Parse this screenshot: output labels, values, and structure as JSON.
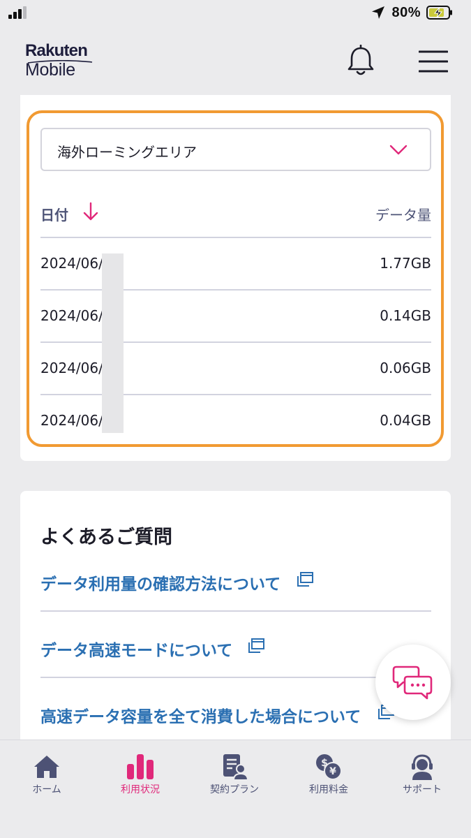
{
  "status_bar": {
    "battery_percent": "80%",
    "icons": [
      "signal-icon",
      "location-arrow-icon",
      "battery-charging-icon"
    ]
  },
  "header": {
    "logo_line1": "Rakuten",
    "logo_line2": "Mobile",
    "icons": [
      "bell-icon",
      "hamburger-menu-icon"
    ]
  },
  "usage_card": {
    "region_select": {
      "value": "海外ローミングエリア",
      "icon": "chevron-down-icon"
    },
    "table": {
      "columns": {
        "date": "日付",
        "data": "データ量"
      },
      "sort_icon": "arrow-down-icon",
      "rows": [
        {
          "date": "2024/06/",
          "value": "1.77GB"
        },
        {
          "date": "2024/06/",
          "value": "0.14GB"
        },
        {
          "date": "2024/06/",
          "value": "0.06GB"
        },
        {
          "date": "2024/06/",
          "value": "0.04GB"
        }
      ]
    }
  },
  "faq": {
    "title": "よくあるご質問",
    "links": [
      {
        "label": "データ利用量の確認方法について",
        "icon": "external-window-icon"
      },
      {
        "label": "データ高速モードについて",
        "icon": "external-window-icon"
      },
      {
        "label": "高速データ容量を全て消費した場合について",
        "icon": "external-window-icon"
      }
    ]
  },
  "chat_fab": {
    "icon": "chat-bubbles-icon"
  },
  "bottom_nav": {
    "items": [
      {
        "label": "ホーム",
        "icon": "home-icon",
        "active": false
      },
      {
        "label": "利用状況",
        "icon": "bar-chart-icon",
        "active": true
      },
      {
        "label": "契約プラン",
        "icon": "contract-icon",
        "active": false
      },
      {
        "label": "利用料金",
        "icon": "fee-icon",
        "active": false
      },
      {
        "label": "サポート",
        "icon": "support-icon",
        "active": false
      }
    ]
  },
  "colors": {
    "accent_pink": "#e0287a",
    "link_blue": "#2a6fb2",
    "highlight_orange": "#f19a32",
    "nav_gray": "#4d5275"
  }
}
